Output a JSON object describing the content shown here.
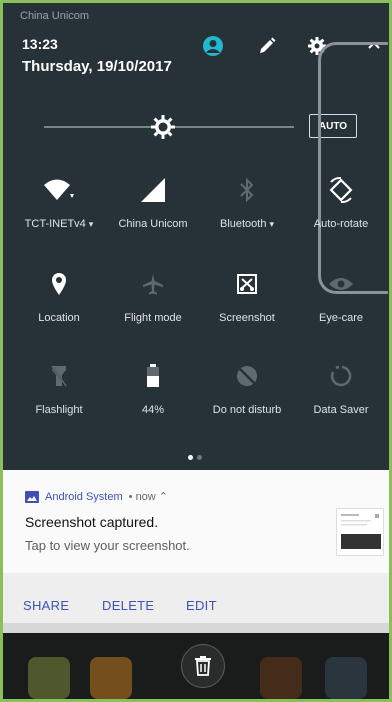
{
  "status_bar": {
    "carrier": "China Unicom"
  },
  "header": {
    "time": "13:23",
    "date": "Thursday, 19/10/2017",
    "icons": [
      "account-icon",
      "edit-icon",
      "settings-icon",
      "collapse-chevron-icon"
    ]
  },
  "brightness": {
    "level": 0.47,
    "auto_label": "AUTO"
  },
  "tiles": [
    {
      "name": "wifi",
      "label": "TCT-INETv4",
      "dropdown": true,
      "active": true
    },
    {
      "name": "mobile-data",
      "label": "China Unicom",
      "dropdown": false,
      "active": true
    },
    {
      "name": "bluetooth",
      "label": "Bluetooth",
      "dropdown": true,
      "active": false
    },
    {
      "name": "auto-rotate",
      "label": "Auto-rotate",
      "dropdown": false,
      "active": true
    },
    {
      "name": "location",
      "label": "Location",
      "dropdown": false,
      "active": true
    },
    {
      "name": "flight-mode",
      "label": "Flight mode",
      "dropdown": false,
      "active": false
    },
    {
      "name": "screenshot",
      "label": "Screenshot",
      "dropdown": false,
      "active": true
    },
    {
      "name": "eye-care",
      "label": "Eye-care",
      "dropdown": false,
      "active": false
    },
    {
      "name": "flashlight",
      "label": "Flashlight",
      "dropdown": false,
      "active": false
    },
    {
      "name": "battery",
      "label": "44%",
      "dropdown": false,
      "active": true
    },
    {
      "name": "do-not-disturb",
      "label": "Do not disturb",
      "dropdown": false,
      "active": false
    },
    {
      "name": "data-saver",
      "label": "Data Saver",
      "dropdown": false,
      "active": false
    }
  ],
  "dropdown_glyph": "▾",
  "pager": {
    "current": 1,
    "total": 2
  },
  "notification": {
    "app": "Android System",
    "meta": "• now ⌃",
    "title": "Screenshot captured.",
    "text": "Tap to view your screenshot.",
    "actions": [
      "SHARE",
      "DELETE",
      "EDIT"
    ]
  },
  "colors": {
    "shade": "#263238",
    "accent": "#3f51b5",
    "frame": "#8bbf5a"
  }
}
